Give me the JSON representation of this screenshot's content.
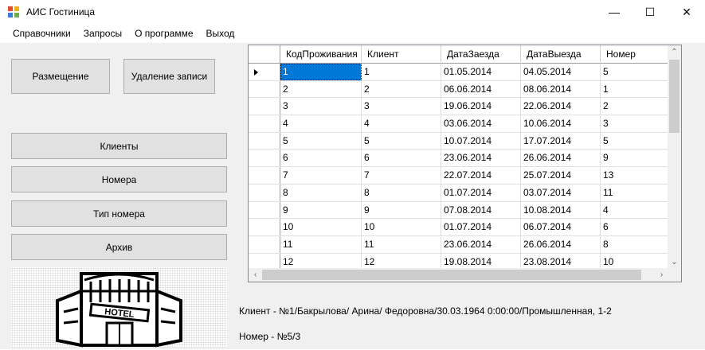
{
  "window": {
    "title": "АИС Гостиница",
    "controls": {
      "minimize": "—",
      "maximize": "☐",
      "close": "✕"
    }
  },
  "menu": [
    "Справочники",
    "Запросы",
    "О программе",
    "Выход"
  ],
  "buttons": {
    "placement": "Размещение",
    "delete_record": "Удаление записи",
    "clients": "Клиенты",
    "rooms": "Номера",
    "room_type": "Тип номера",
    "archive": "Архив"
  },
  "grid": {
    "columns": [
      "КодПроживания",
      "Клиент",
      "ДатаЗаезда",
      "ДатаВыезда",
      "Номер"
    ],
    "rows": [
      [
        "1",
        "1",
        "01.05.2014",
        "04.05.2014",
        "5"
      ],
      [
        "2",
        "2",
        "06.06.2014",
        "08.06.2014",
        "1"
      ],
      [
        "3",
        "3",
        "19.06.2014",
        "22.06.2014",
        "2"
      ],
      [
        "4",
        "4",
        "03.06.2014",
        "10.06.2014",
        "3"
      ],
      [
        "5",
        "5",
        "10.07.2014",
        "17.07.2014",
        "5"
      ],
      [
        "6",
        "6",
        "23.06.2014",
        "26.06.2014",
        "9"
      ],
      [
        "7",
        "7",
        "22.07.2014",
        "25.07.2014",
        "13"
      ],
      [
        "8",
        "8",
        "01.07.2014",
        "03.07.2014",
        "11"
      ],
      [
        "9",
        "9",
        "07.08.2014",
        "10.08.2014",
        "4"
      ],
      [
        "10",
        "10",
        "01.07.2014",
        "06.07.2014",
        "6"
      ],
      [
        "11",
        "11",
        "23.06.2014",
        "26.06.2014",
        "8"
      ],
      [
        "12",
        "12",
        "19.08.2014",
        "23.08.2014",
        "10"
      ]
    ],
    "selected_row": 0
  },
  "status": {
    "client": "Клиент - №1/Бакрылова/ Арина/ Федоровна/30.03.1964 0:00:00/Промышленная, 1-2",
    "room": "Номер - №5/3"
  },
  "logo": {
    "text": "HOTEL",
    "icon": "hotel-building-icon"
  },
  "colors": {
    "selection": "#0078d7",
    "panel": "#f0f0f0",
    "button": "#e1e1e1"
  }
}
